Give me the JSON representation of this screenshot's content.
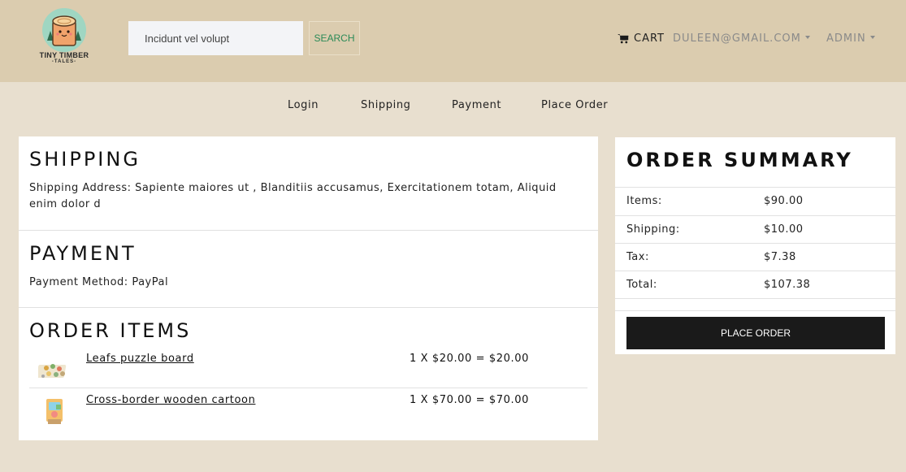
{
  "header": {
    "logo": {
      "line1": "TINY TIMBER",
      "line2": "-TALES-"
    },
    "search": {
      "value": "Incidunt vel volupt",
      "button_label": "SEARCH"
    },
    "cart_label": "CART",
    "user_email": "DULEEN@GMAIL.COM",
    "admin_label": "ADMIN"
  },
  "steps": [
    "Login",
    "Shipping",
    "Payment",
    "Place Order"
  ],
  "shipping": {
    "title": "SHIPPING",
    "address_text": "Shipping Address: Sapiente maiores ut , Blanditiis accusamus, Exercitationem totam, Aliquid enim dolor d"
  },
  "payment": {
    "title": "PAYMENT",
    "method_text": "Payment Method: PayPal"
  },
  "order_items": {
    "title": "ORDER ITEMS",
    "items": [
      {
        "name": "Leafs puzzle board",
        "price_text": "1 X $20.00 = $20.00",
        "icon": "puzzle-board-image"
      },
      {
        "name": "Cross-border wooden cartoon",
        "price_text": "1 X $70.00 = $70.00",
        "icon": "wooden-cartoon-image"
      }
    ]
  },
  "summary": {
    "title": "ORDER SUMMARY",
    "rows": [
      {
        "label": "Items:",
        "value": "$90.00"
      },
      {
        "label": "Shipping:",
        "value": "$10.00"
      },
      {
        "label": "Tax:",
        "value": "$7.38"
      },
      {
        "label": "Total:",
        "value": "$107.38"
      }
    ],
    "button_label": "PLACE ORDER"
  },
  "colors": {
    "header_bg": "#dbccaf",
    "page_bg": "#e8dfcf",
    "search_accent": "#2a8a57",
    "button_bg": "#1a1a1a"
  }
}
